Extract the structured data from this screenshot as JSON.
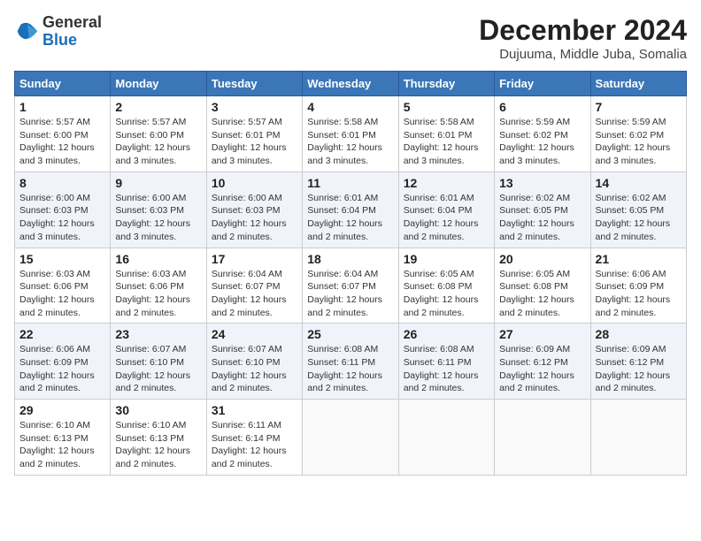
{
  "logo": {
    "general": "General",
    "blue": "Blue"
  },
  "title": "December 2024",
  "subtitle": "Dujuuma, Middle Juba, Somalia",
  "headers": [
    "Sunday",
    "Monday",
    "Tuesday",
    "Wednesday",
    "Thursday",
    "Friday",
    "Saturday"
  ],
  "weeks": [
    [
      {
        "day": "1",
        "sunrise": "5:57 AM",
        "sunset": "6:00 PM",
        "daylight": "12 hours and 3 minutes."
      },
      {
        "day": "2",
        "sunrise": "5:57 AM",
        "sunset": "6:00 PM",
        "daylight": "12 hours and 3 minutes."
      },
      {
        "day": "3",
        "sunrise": "5:57 AM",
        "sunset": "6:01 PM",
        "daylight": "12 hours and 3 minutes."
      },
      {
        "day": "4",
        "sunrise": "5:58 AM",
        "sunset": "6:01 PM",
        "daylight": "12 hours and 3 minutes."
      },
      {
        "day": "5",
        "sunrise": "5:58 AM",
        "sunset": "6:01 PM",
        "daylight": "12 hours and 3 minutes."
      },
      {
        "day": "6",
        "sunrise": "5:59 AM",
        "sunset": "6:02 PM",
        "daylight": "12 hours and 3 minutes."
      },
      {
        "day": "7",
        "sunrise": "5:59 AM",
        "sunset": "6:02 PM",
        "daylight": "12 hours and 3 minutes."
      }
    ],
    [
      {
        "day": "8",
        "sunrise": "6:00 AM",
        "sunset": "6:03 PM",
        "daylight": "12 hours and 3 minutes."
      },
      {
        "day": "9",
        "sunrise": "6:00 AM",
        "sunset": "6:03 PM",
        "daylight": "12 hours and 3 minutes."
      },
      {
        "day": "10",
        "sunrise": "6:00 AM",
        "sunset": "6:03 PM",
        "daylight": "12 hours and 2 minutes."
      },
      {
        "day": "11",
        "sunrise": "6:01 AM",
        "sunset": "6:04 PM",
        "daylight": "12 hours and 2 minutes."
      },
      {
        "day": "12",
        "sunrise": "6:01 AM",
        "sunset": "6:04 PM",
        "daylight": "12 hours and 2 minutes."
      },
      {
        "day": "13",
        "sunrise": "6:02 AM",
        "sunset": "6:05 PM",
        "daylight": "12 hours and 2 minutes."
      },
      {
        "day": "14",
        "sunrise": "6:02 AM",
        "sunset": "6:05 PM",
        "daylight": "12 hours and 2 minutes."
      }
    ],
    [
      {
        "day": "15",
        "sunrise": "6:03 AM",
        "sunset": "6:06 PM",
        "daylight": "12 hours and 2 minutes."
      },
      {
        "day": "16",
        "sunrise": "6:03 AM",
        "sunset": "6:06 PM",
        "daylight": "12 hours and 2 minutes."
      },
      {
        "day": "17",
        "sunrise": "6:04 AM",
        "sunset": "6:07 PM",
        "daylight": "12 hours and 2 minutes."
      },
      {
        "day": "18",
        "sunrise": "6:04 AM",
        "sunset": "6:07 PM",
        "daylight": "12 hours and 2 minutes."
      },
      {
        "day": "19",
        "sunrise": "6:05 AM",
        "sunset": "6:08 PM",
        "daylight": "12 hours and 2 minutes."
      },
      {
        "day": "20",
        "sunrise": "6:05 AM",
        "sunset": "6:08 PM",
        "daylight": "12 hours and 2 minutes."
      },
      {
        "day": "21",
        "sunrise": "6:06 AM",
        "sunset": "6:09 PM",
        "daylight": "12 hours and 2 minutes."
      }
    ],
    [
      {
        "day": "22",
        "sunrise": "6:06 AM",
        "sunset": "6:09 PM",
        "daylight": "12 hours and 2 minutes."
      },
      {
        "day": "23",
        "sunrise": "6:07 AM",
        "sunset": "6:10 PM",
        "daylight": "12 hours and 2 minutes."
      },
      {
        "day": "24",
        "sunrise": "6:07 AM",
        "sunset": "6:10 PM",
        "daylight": "12 hours and 2 minutes."
      },
      {
        "day": "25",
        "sunrise": "6:08 AM",
        "sunset": "6:11 PM",
        "daylight": "12 hours and 2 minutes."
      },
      {
        "day": "26",
        "sunrise": "6:08 AM",
        "sunset": "6:11 PM",
        "daylight": "12 hours and 2 minutes."
      },
      {
        "day": "27",
        "sunrise": "6:09 AM",
        "sunset": "6:12 PM",
        "daylight": "12 hours and 2 minutes."
      },
      {
        "day": "28",
        "sunrise": "6:09 AM",
        "sunset": "6:12 PM",
        "daylight": "12 hours and 2 minutes."
      }
    ],
    [
      {
        "day": "29",
        "sunrise": "6:10 AM",
        "sunset": "6:13 PM",
        "daylight": "12 hours and 2 minutes."
      },
      {
        "day": "30",
        "sunrise": "6:10 AM",
        "sunset": "6:13 PM",
        "daylight": "12 hours and 2 minutes."
      },
      {
        "day": "31",
        "sunrise": "6:11 AM",
        "sunset": "6:14 PM",
        "daylight": "12 hours and 2 minutes."
      },
      null,
      null,
      null,
      null
    ]
  ]
}
